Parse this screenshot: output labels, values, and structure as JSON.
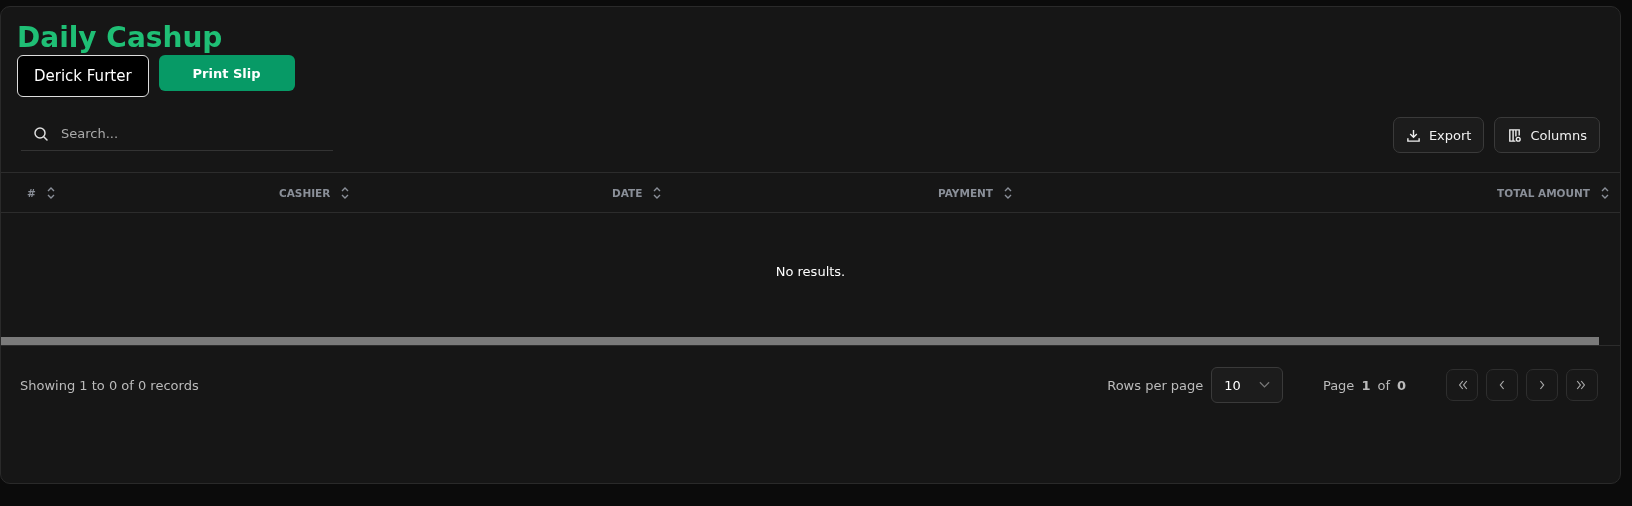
{
  "title": "Daily Cashup",
  "cashier_button": "Derick Furter",
  "print_button": "Print Slip",
  "search": {
    "placeholder": "Search..."
  },
  "toolbar": [
    {
      "kind": "export",
      "label": "Export"
    },
    {
      "kind": "columns",
      "label": "Columns"
    }
  ],
  "table": {
    "columns": [
      {
        "label": "#"
      },
      {
        "label": "CASHIER"
      },
      {
        "label": "DATE"
      },
      {
        "label": "PAYMENT"
      },
      {
        "label": "TOTAL AMOUNT"
      }
    ],
    "empty_message": "No results."
  },
  "footer": {
    "summary": "Showing 1 to 0 of 0 records",
    "rows_label": "Rows per page",
    "rows_value": "10",
    "page_word": "Page",
    "page_current": "1",
    "of_word": "of",
    "page_total": "0",
    "nav": [
      {
        "kind": "first",
        "disabled": true
      },
      {
        "kind": "prev",
        "disabled": true
      },
      {
        "kind": "next",
        "disabled": true
      },
      {
        "kind": "last",
        "disabled": true
      }
    ]
  }
}
